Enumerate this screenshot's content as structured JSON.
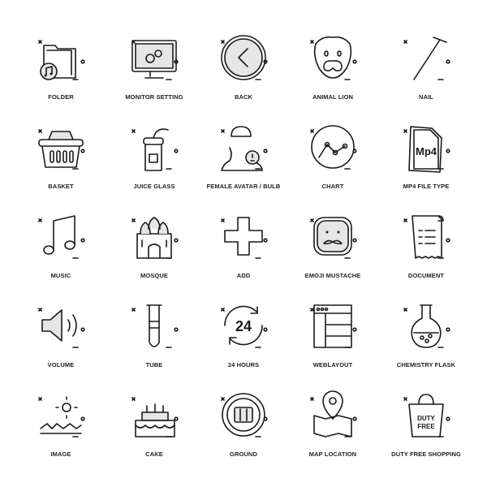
{
  "icons": [
    {
      "label": "FOLDER",
      "icon": "folder-music-icon"
    },
    {
      "label": "MONITOR SETTING",
      "icon": "monitor-gears-icon"
    },
    {
      "label": "BACK",
      "icon": "back-chevron-icon"
    },
    {
      "label": "ANIMAL LION",
      "icon": "lion-face-icon"
    },
    {
      "label": "NAIL",
      "icon": "nail-icon"
    },
    {
      "label": "BASKET",
      "icon": "basket-icon"
    },
    {
      "label": "JUICE GLASS",
      "icon": "juice-glass-icon"
    },
    {
      "label": "FEMALE AVATAR / BULB",
      "icon": "female-avatar-bulb-icon"
    },
    {
      "label": "CHART",
      "icon": "line-chart-icon"
    },
    {
      "label": "MP4 FILE TYPE",
      "icon": "mp4-file-icon",
      "text": "Mp4"
    },
    {
      "label": "MUSIC",
      "icon": "music-note-icon"
    },
    {
      "label": "MOSQUE",
      "icon": "mosque-icon"
    },
    {
      "label": "ADD",
      "icon": "plus-icon"
    },
    {
      "label": "EMOJI MUSTACHE",
      "icon": "emoji-mustache-icon"
    },
    {
      "label": "DOCUMENT",
      "icon": "document-icon"
    },
    {
      "label": "VOLUME",
      "icon": "speaker-volume-icon"
    },
    {
      "label": "TUBE",
      "icon": "test-tube-icon"
    },
    {
      "label": "24 HOURS",
      "icon": "24-hours-icon",
      "text": "24"
    },
    {
      "label": "WEBLAYOUT",
      "icon": "web-layout-icon"
    },
    {
      "label": "CHEMISTRY FLASK",
      "icon": "chemistry-flask-icon"
    },
    {
      "label": "IMAGE",
      "icon": "image-landscape-icon"
    },
    {
      "label": "CAKE",
      "icon": "birthday-cake-icon"
    },
    {
      "label": "GROUND",
      "icon": "ground-icon"
    },
    {
      "label": "MAP LOCATION",
      "icon": "map-location-icon"
    },
    {
      "label": "DUTY FREE SHOPPING",
      "icon": "duty-free-bag-icon",
      "text": "DUTY FREE"
    }
  ]
}
